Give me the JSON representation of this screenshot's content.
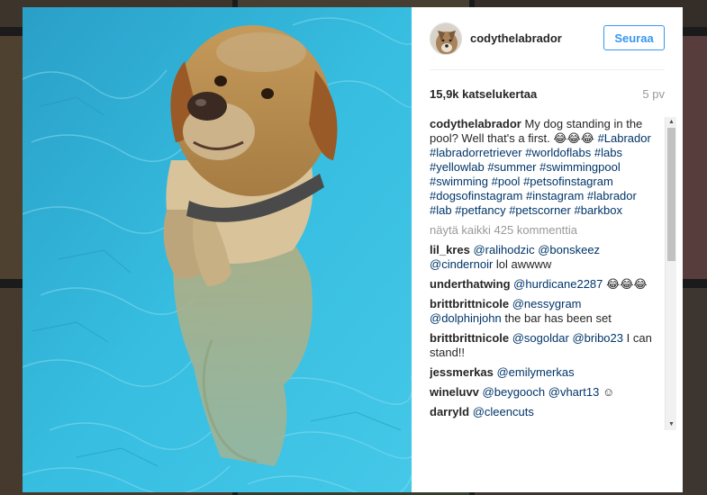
{
  "post": {
    "username": "cody​thelabrador",
    "follow_label": "Seuraa",
    "views": "15,9k katselukertaa",
    "age": "5 pv"
  },
  "caption": {
    "username": "codythelabrador",
    "text": "My dog standing in the pool? Well that's a first. 😂😂😂",
    "tags": [
      "#Labrador",
      "#labradorretriever",
      "#worldoflabs",
      "#labs",
      "#yellowlab",
      "#summer",
      "#swimmingpool",
      "#swimming",
      "#pool",
      "#petsofinstagram",
      "#dogsofinstagram",
      "#instagram",
      "#labrador",
      "#lab",
      "#petfancy",
      "#petscorner",
      "#barkbox"
    ]
  },
  "load_more_label": "näytä kaikki 425 kommenttia",
  "comments": [
    {
      "user": "lil_kres",
      "mentions": [
        "@ralihodzic",
        "@bonskeez",
        "@cindernoir"
      ],
      "text": "lol awwww"
    },
    {
      "user": "underthatwing",
      "mentions": [
        "@hurdicane2287"
      ],
      "text": "😂😂😂"
    },
    {
      "user": "brittbrittnicole",
      "mentions": [
        "@nessygram",
        "@dolphinjohn"
      ],
      "text": "the bar has been set"
    },
    {
      "user": "brittbrittnicole",
      "mentions": [
        "@sogoldar",
        "@bribo23"
      ],
      "text": "I can stand!!"
    },
    {
      "user": "jessmerkas",
      "mentions": [
        "@emilymerkas"
      ],
      "text": ""
    },
    {
      "user": "wineluvv",
      "mentions": [
        "@beygooch",
        "@vhart13"
      ],
      "text": "☺"
    },
    {
      "user": "darryld",
      "mentions": [
        "@cleencuts"
      ],
      "text": ""
    }
  ],
  "colors": {
    "link": "#003569",
    "follow": "#3897f0",
    "muted": "#999999",
    "pool": "#2fb5d6"
  },
  "icons": {
    "scroll_up": "scroll-up-arrow-icon",
    "scroll_down": "scroll-down-arrow-icon"
  }
}
